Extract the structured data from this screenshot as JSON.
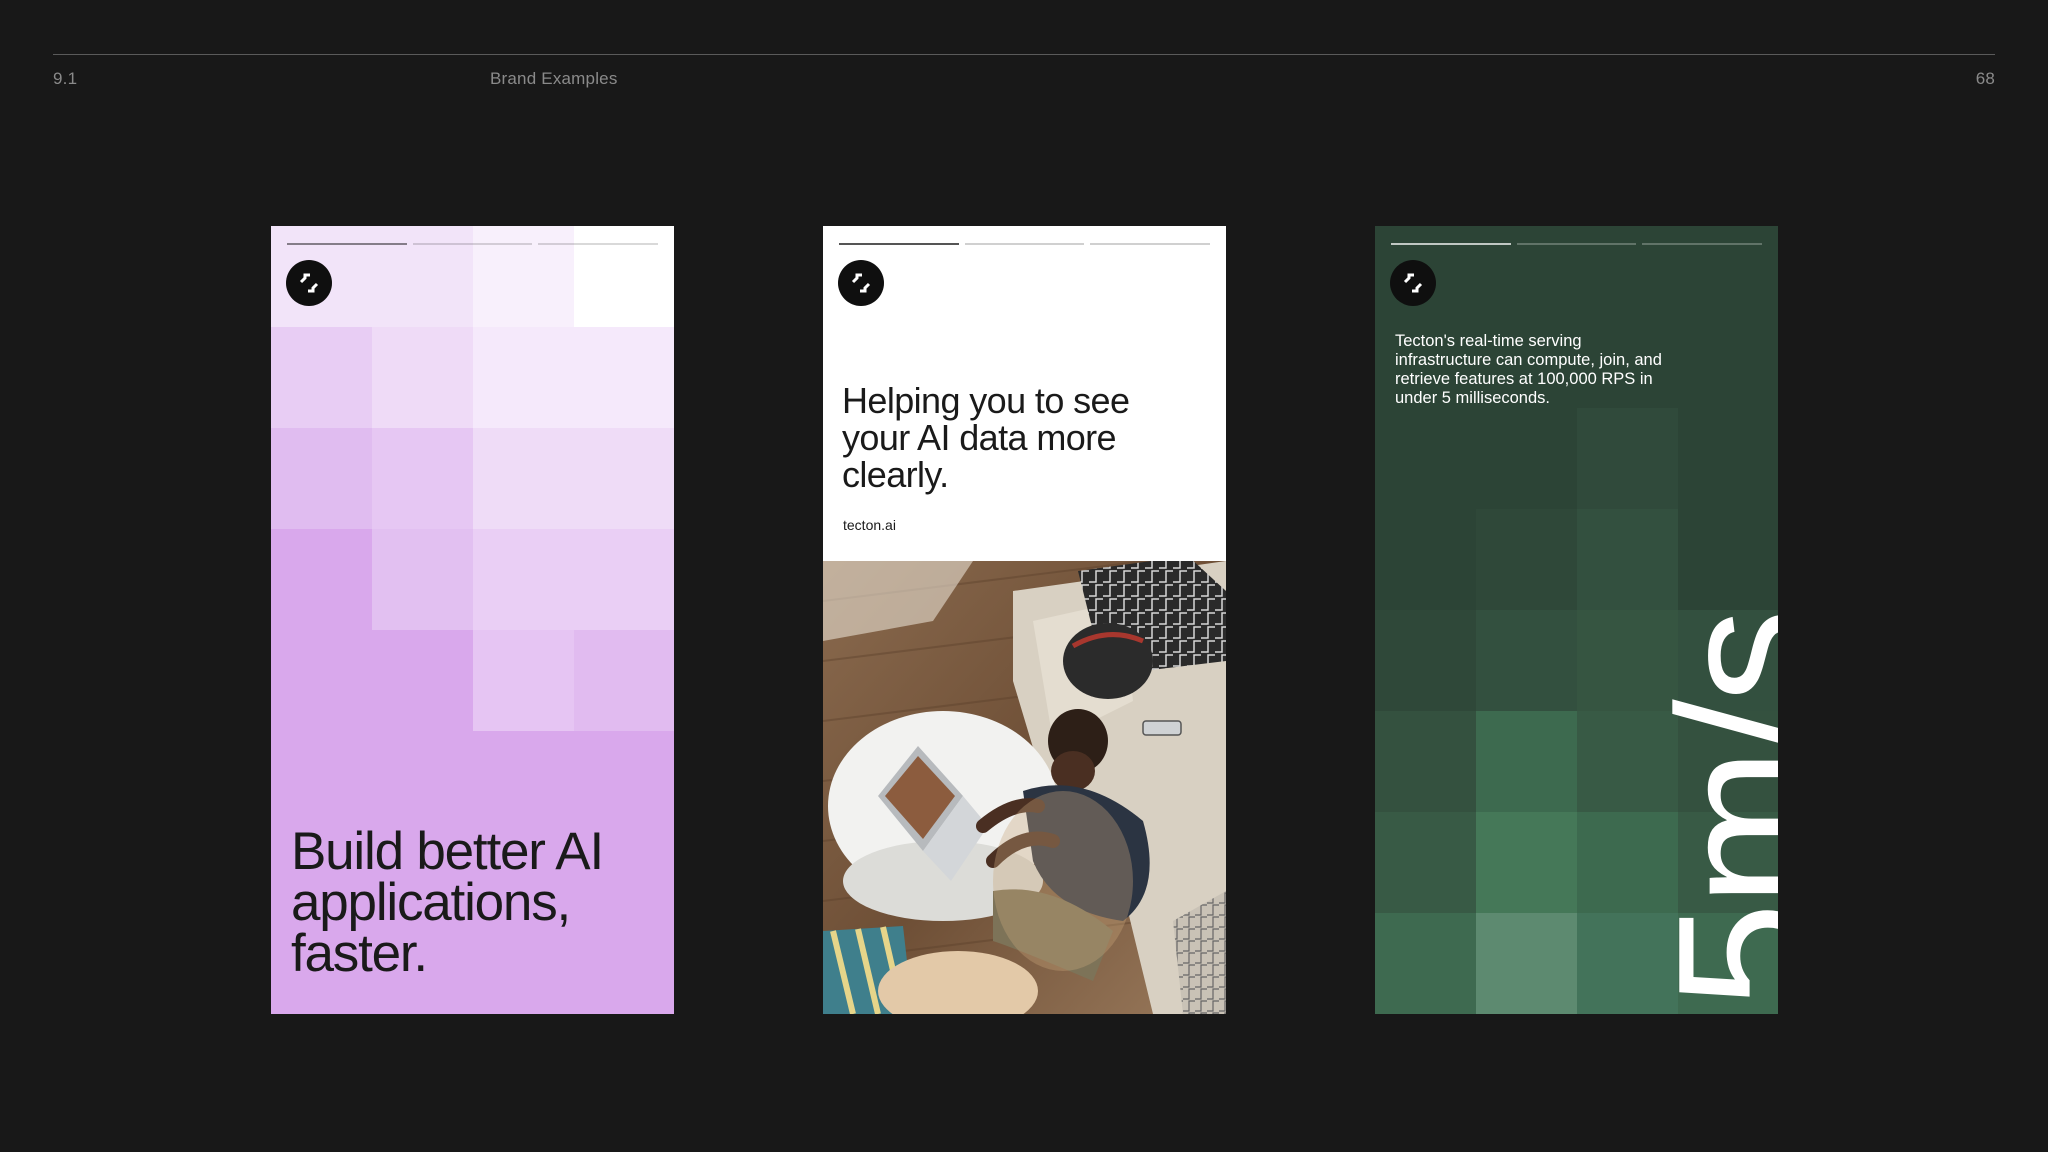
{
  "header": {
    "section_number": "9.1",
    "section_title": "Brand Examples",
    "page_number": "68"
  },
  "cards": [
    {
      "headline": "Build better AI applications, faster.",
      "progress_segments": 3,
      "active_segment": 1,
      "background": "#d9a8ec"
    },
    {
      "headline": "Helping you to see your AI data more clearly.",
      "domain": "tecton.ai",
      "progress_segments": 3,
      "active_segment": 1,
      "background": "#ffffff"
    },
    {
      "body": "Tecton's real-time serving infrastructure  can compute, join, and retrieve features at 100,000 RPS in under 5 milliseconds.",
      "big_text": "5m/s",
      "progress_segments": 3,
      "active_segment": 1,
      "background": "#2c4436"
    }
  ],
  "logo": {
    "icon": "tecton-logo-icon",
    "color": "#0f0f0f"
  },
  "colors": {
    "page_background": "#181818",
    "header_text": "#8a8a8a"
  }
}
